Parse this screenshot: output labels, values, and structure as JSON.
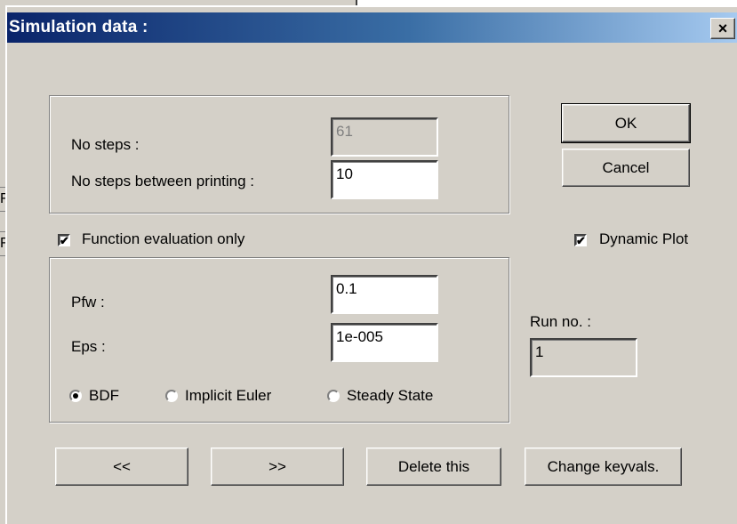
{
  "dialog": {
    "title": "Simulation data :",
    "close_glyph": "×",
    "close_icon": "close-icon"
  },
  "background_app": {
    "fragment_1": "F",
    "fragment_2": "F"
  },
  "steps": {
    "no_steps_label": "No steps :",
    "no_steps_value": "61",
    "printing_label": "No steps between printing :",
    "printing_value": "10"
  },
  "function_eval": {
    "label": "Function evaluation  only",
    "checked": true
  },
  "dynamic_plot": {
    "label": "Dynamic Plot",
    "checked": true
  },
  "params": {
    "pfw_label": "Pfw :",
    "pfw_value": "0.1",
    "eps_label": "Eps :",
    "eps_value": "1e-005"
  },
  "method": {
    "options": [
      "BDF",
      "Implicit Euler",
      "Steady State"
    ],
    "selected": "BDF"
  },
  "run": {
    "label": "Run no. :",
    "value": "1"
  },
  "buttons": {
    "ok": "OK",
    "cancel": "Cancel",
    "prev": "<<",
    "next": ">>",
    "delete": "Delete this",
    "change_keyvals": "Change keyvals."
  },
  "check_glyph": "✔"
}
